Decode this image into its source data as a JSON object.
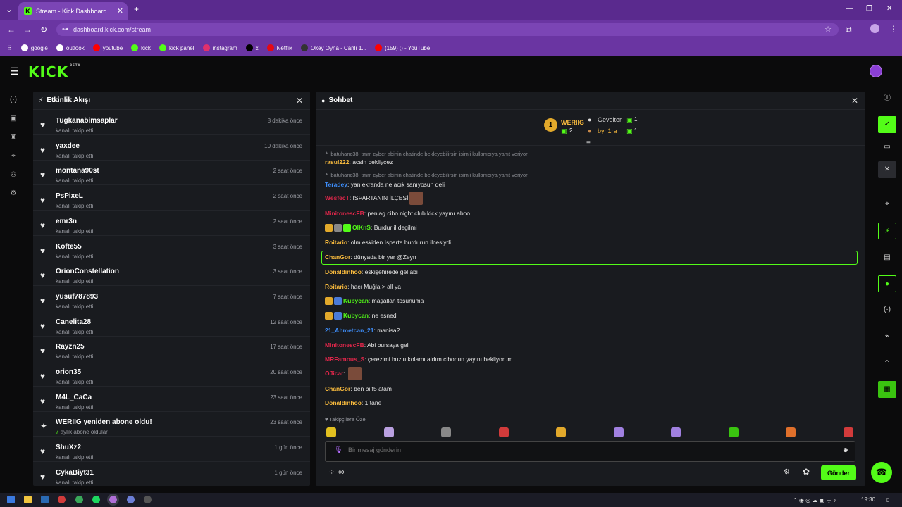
{
  "browser": {
    "tab_title": "Stream - Kick Dashboard",
    "tab_favicon": "K",
    "url": "dashboard.kick.com/stream",
    "bookmarks": [
      {
        "label": "google",
        "color": "#ffffff"
      },
      {
        "label": "outlook",
        "color": "#ffffff"
      },
      {
        "label": "youtube",
        "color": "#ff0000"
      },
      {
        "label": "kick",
        "color": "#53fc18"
      },
      {
        "label": "kick panel",
        "color": "#53fc18"
      },
      {
        "label": "instagram",
        "color": "#e1306c"
      },
      {
        "label": "x",
        "color": "#000000"
      },
      {
        "label": "Netflix",
        "color": "#e50914"
      },
      {
        "label": "Okey Oyna - Canlı 1...",
        "color": "#333333"
      },
      {
        "label": "(159) ;) - YouTube",
        "color": "#ff0000"
      }
    ]
  },
  "app": {
    "logo": "KICK",
    "logo_badge": "BETA",
    "accent": "#53fc18"
  },
  "activity": {
    "title": "Etkinlik Akışı",
    "items": [
      {
        "name": "Tugkanabimsaplar",
        "sub": "kanalı takip etti",
        "time": "8 dakika önce",
        "icon": "heart-icon"
      },
      {
        "name": "yaxdee",
        "sub": "kanalı takip etti",
        "time": "10 dakika önce",
        "icon": "heart-icon"
      },
      {
        "name": "montana90st",
        "sub": "kanalı takip etti",
        "time": "2 saat önce",
        "icon": "heart-icon"
      },
      {
        "name": "PsPixeL",
        "sub": "kanalı takip etti",
        "time": "2 saat önce",
        "icon": "heart-icon"
      },
      {
        "name": "emr3n",
        "sub": "kanalı takip etti",
        "time": "2 saat önce",
        "icon": "heart-icon"
      },
      {
        "name": "Kofte55",
        "sub": "kanalı takip etti",
        "time": "3 saat önce",
        "icon": "heart-icon"
      },
      {
        "name": "OrionConstellation",
        "sub": "kanalı takip etti",
        "time": "3 saat önce",
        "icon": "heart-icon"
      },
      {
        "name": "yusuf787893",
        "sub": "kanalı takip etti",
        "time": "7 saat önce",
        "icon": "heart-icon"
      },
      {
        "name": "Canelita28",
        "sub": "kanalı takip etti",
        "time": "12 saat önce",
        "icon": "heart-icon"
      },
      {
        "name": "Rayzn25",
        "sub": "kanalı takip etti",
        "time": "17 saat önce",
        "icon": "heart-icon"
      },
      {
        "name": "orion35",
        "sub": "kanalı takip etti",
        "time": "20 saat önce",
        "icon": "heart-icon"
      },
      {
        "name": "M4L_CaCa",
        "sub": "kanalı takip etti",
        "time": "23 saat önce",
        "icon": "heart-icon"
      },
      {
        "name": "WERIIG yeniden abone oldu!",
        "sub_count": "7",
        "sub": "aylık abone oldular",
        "time": "23 saat önce",
        "icon": "sparkle-icon"
      },
      {
        "name": "ShuXz2",
        "sub": "kanalı takip etti",
        "time": "1 gün önce",
        "icon": "heart-icon"
      },
      {
        "name": "CykaBiyt31",
        "sub": "kanalı takip etti",
        "time": "1 gün önce",
        "icon": "heart-icon"
      }
    ]
  },
  "chat": {
    "title": "Sohbet",
    "leaders": {
      "first": {
        "rank": "1",
        "name": "WERIIG",
        "count": "2"
      },
      "second": {
        "name": "Gevolter",
        "count": "1"
      },
      "third": {
        "name": "byh1ra",
        "count": "1"
      }
    },
    "messages": [
      {
        "reply": "batuhanc38: tmm cyber abinin chatinde bekleyebilirsin isimli kullanıcıya yanıt veriyor"
      },
      {
        "user": "rasul222",
        "color": "#f5b83d",
        "text": "acsin bekliycez"
      },
      {
        "reply": "batuhanc38: tmm cyber abinin chatinde bekleyebilirsin isimli kullanıcıya yanıt veriyor"
      },
      {
        "user": "Teradey",
        "color": "#3d8bf5",
        "text": "yan ekranda ne acık sanıyosun deli"
      },
      {
        "user": "WesfecT",
        "color": "#e0264a",
        "text": "ISPARTANIN İLÇESİ"
      },
      {
        "user": "MinitonescFB",
        "color": "#e0264a",
        "text": "peniag cibo night club kick yayını aboo"
      },
      {
        "user": "OlKnS",
        "color": "#53fc18",
        "text": "Burdur il degilmi"
      },
      {
        "user": "Roitario",
        "color": "#f5b83d",
        "text": "olm eskiden Isparta burdurun ilcesiydi"
      },
      {
        "user": "ChanGor",
        "color": "#f5b83d",
        "text": "dünyada bir yer @Zeyn"
      },
      {
        "user": "Donaldinhoo",
        "color": "#f5b83d",
        "text": "eskişehirede gel abi"
      },
      {
        "user": "Roitario",
        "color": "#f5b83d",
        "text": "hacı Muğla > all ya"
      },
      {
        "user": "Kubycan",
        "color": "#53fc18",
        "text": "maşallah tosunuma"
      },
      {
        "user": "Kubycan",
        "color": "#53fc18",
        "text": "ne esnedi"
      },
      {
        "user": "21_Ahmetcan_21",
        "color": "#3d8bf5",
        "text": "manisa?"
      },
      {
        "user": "MinitonescFB",
        "color": "#e0264a",
        "text": "Abi bursaya gel"
      },
      {
        "user": "MRFamous_S",
        "color": "#e0264a",
        "text": "çerezimi buzlu kolamı aldım cibonun yayını bekliyorum"
      },
      {
        "user": "OJicar",
        "color": "#e0264a",
        "text": ""
      },
      {
        "user": "ChanGor",
        "color": "#f5b83d",
        "text": "ben bi f5 atam"
      },
      {
        "user": "Donaldinhoo",
        "color": "#f5b83d",
        "text": "1 tane"
      }
    ],
    "followers_only": "Takipçilere Özel",
    "input_placeholder": "Bir mesaj gönderin",
    "send_label": "Gönder",
    "infinity": "∞"
  },
  "taskbar": {
    "time": "19:30"
  }
}
